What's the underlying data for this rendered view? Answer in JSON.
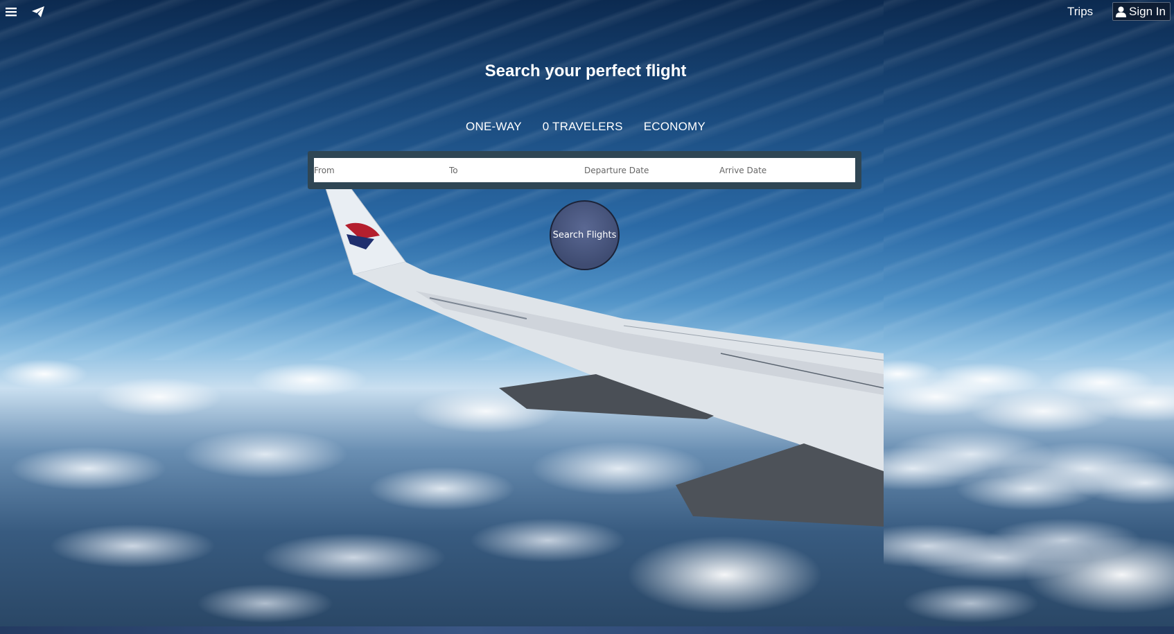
{
  "header": {
    "menu_icon": "menu-icon",
    "brand_icon": "paper-plane-icon",
    "trips_label": "Trips",
    "signin_icon": "user-icon",
    "signin_label": "Sign In"
  },
  "hero": {
    "title": "Search your perfect flight"
  },
  "options": {
    "trip_type": "ONE-WAY",
    "travelers": "0 TRAVELERS",
    "cabin": "ECONOMY"
  },
  "search": {
    "from_placeholder": "From",
    "to_placeholder": "To",
    "departure_placeholder": "Departure Date",
    "arrive_placeholder": "Arrive Date",
    "submit_label": "Search Flights"
  },
  "colors": {
    "panel": "#2f4654",
    "button": "#4a577f",
    "signin_bg": "#0e1d33"
  }
}
